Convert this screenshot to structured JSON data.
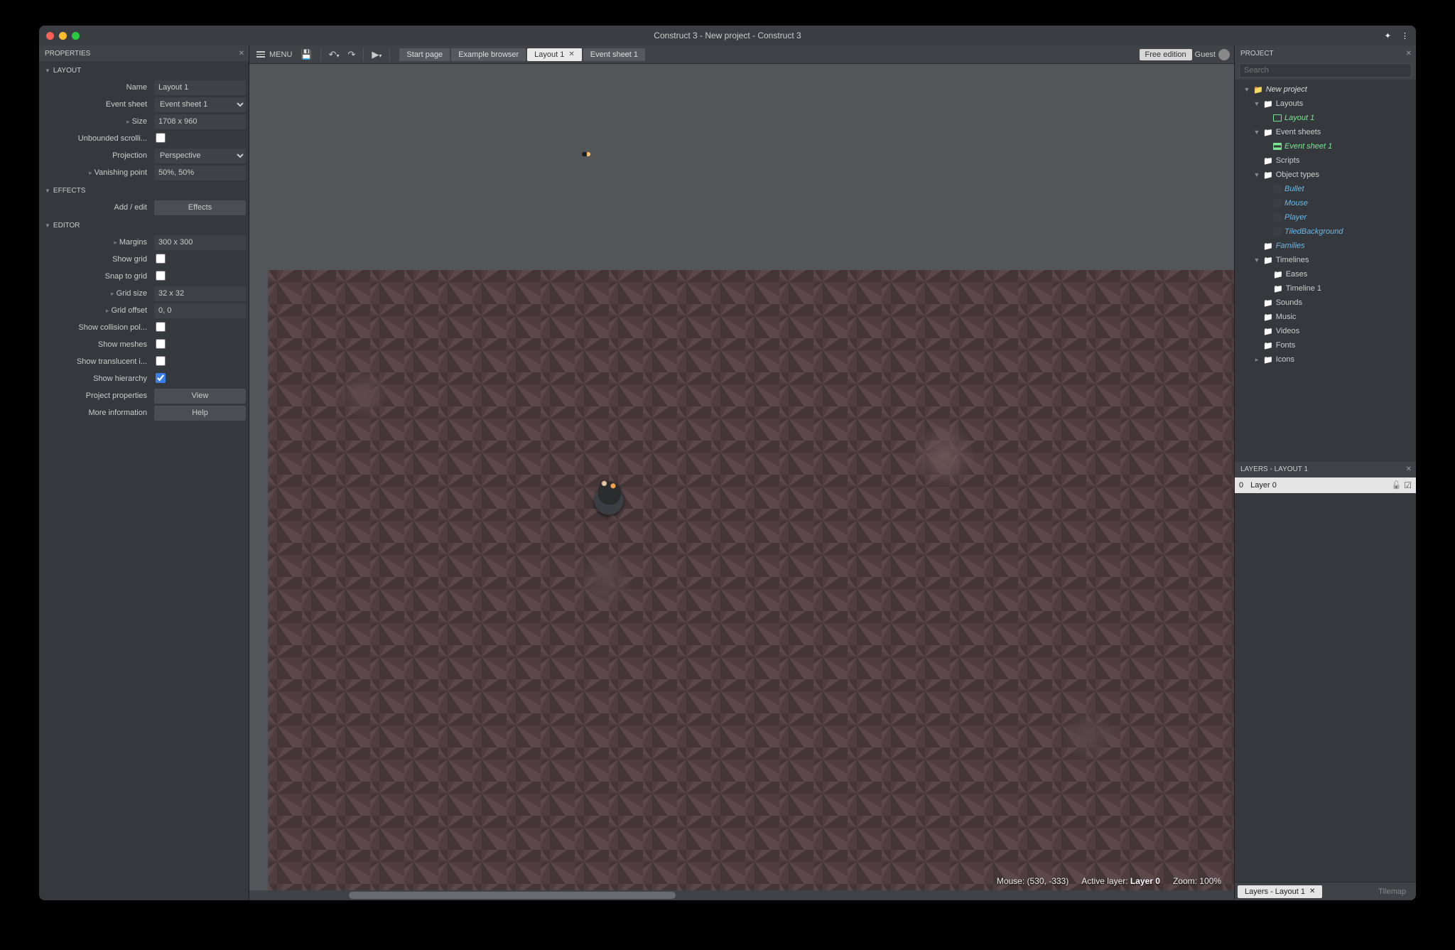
{
  "titlebar": {
    "title": "Construct 3 - New project - Construct 3"
  },
  "properties_panel": {
    "title": "PROPERTIES"
  },
  "layout_section": {
    "title": "LAYOUT",
    "name_label": "Name",
    "name_value": "Layout 1",
    "event_sheet_label": "Event sheet",
    "event_sheet_value": "Event sheet 1",
    "size_label": "Size",
    "size_value": "1708 x 960",
    "unbounded_label": "Unbounded scrolli...",
    "projection_label": "Projection",
    "projection_value": "Perspective",
    "vanishing_label": "Vanishing point",
    "vanishing_value": "50%, 50%"
  },
  "effects_section": {
    "title": "EFFECTS",
    "addedit_label": "Add / edit",
    "addedit_btn": "Effects"
  },
  "editor_section": {
    "title": "EDITOR",
    "margins_label": "Margins",
    "margins_value": "300 x 300",
    "showgrid_label": "Show grid",
    "snap_label": "Snap to grid",
    "gridsize_label": "Grid size",
    "gridsize_value": "32 x 32",
    "gridoffset_label": "Grid offset",
    "gridoffset_value": "0, 0",
    "collision_label": "Show collision pol...",
    "meshes_label": "Show meshes",
    "translucent_label": "Show translucent i...",
    "hierarchy_label": "Show hierarchy",
    "projprops_label": "Project properties",
    "projprops_btn": "View",
    "moreinfo_label": "More information",
    "moreinfo_btn": "Help"
  },
  "toolbar": {
    "menu": "MENU",
    "tabs": [
      {
        "label": "Start page",
        "active": false,
        "closable": false
      },
      {
        "label": "Example browser",
        "active": false,
        "closable": false
      },
      {
        "label": "Layout 1",
        "active": true,
        "closable": true
      },
      {
        "label": "Event sheet 1",
        "active": false,
        "closable": false
      }
    ],
    "free_edition": "Free edition",
    "guest": "Guest"
  },
  "status": {
    "mouse": "Mouse: (530, -333)",
    "active_layer_label": "Active layer:",
    "active_layer": "Layer 0",
    "zoom": "Zoom: 100%"
  },
  "project_panel": {
    "title": "PROJECT",
    "search_placeholder": "Search"
  },
  "project_tree": {
    "root": "New project",
    "layouts": "Layouts",
    "layout1": "Layout 1",
    "event_sheets": "Event sheets",
    "es1": "Event sheet 1",
    "scripts": "Scripts",
    "object_types": "Object types",
    "bullet": "Bullet",
    "mouse": "Mouse",
    "player": "Player",
    "tiledbg": "TiledBackground",
    "families": "Families",
    "timelines": "Timelines",
    "eases": "Eases",
    "timeline1": "Timeline 1",
    "sounds": "Sounds",
    "music": "Music",
    "videos": "Videos",
    "fonts": "Fonts",
    "icons": "Icons"
  },
  "layers_panel": {
    "title": "LAYERS - LAYOUT 1",
    "layer0_idx": "0",
    "layer0_name": "Layer 0"
  },
  "bottom_tabs": {
    "layers": "Layers - Layout 1",
    "tilemap": "Tilemap"
  }
}
